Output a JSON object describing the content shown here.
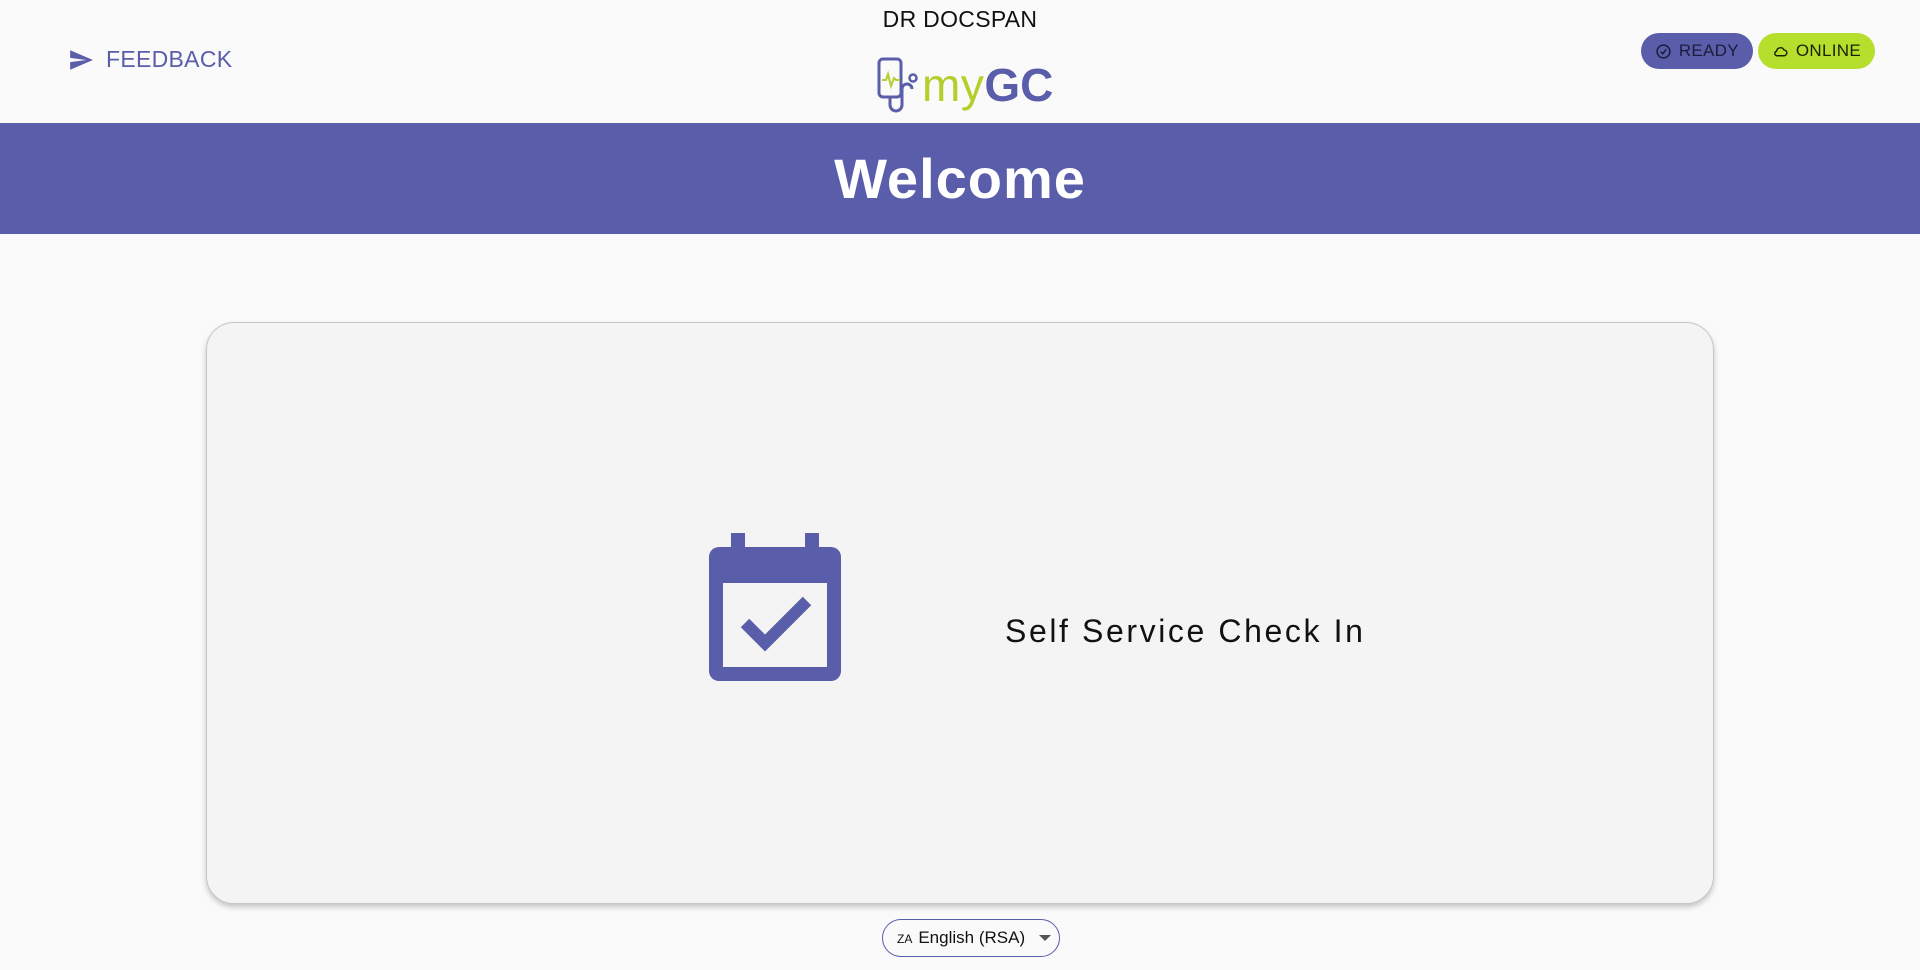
{
  "header": {
    "feedback_label": "FEEDBACK",
    "clinic_name": "DR DOCSPAN",
    "logo": {
      "my": "my",
      "gc": "GC"
    },
    "status": {
      "ready_label": "READY",
      "online_label": "ONLINE"
    }
  },
  "banner": {
    "title": "Welcome"
  },
  "main": {
    "card": {
      "icon": "calendar-check-icon",
      "label": "Self Service Check In"
    }
  },
  "language": {
    "flag_code": "ZA",
    "selected": "English (RSA)"
  },
  "colors": {
    "primary": "#5a5da9",
    "accent": "#b6de2d",
    "background": "#fafafa",
    "card": "#f4f4f4"
  }
}
